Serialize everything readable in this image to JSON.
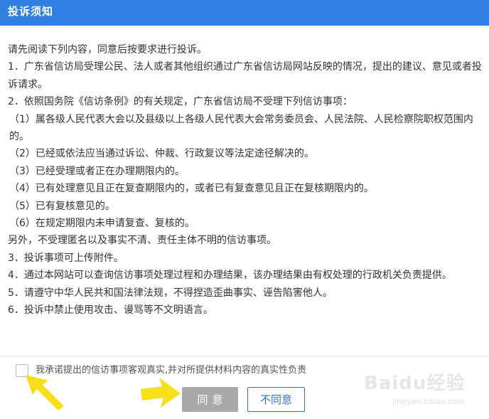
{
  "dialog": {
    "title": "投诉须知"
  },
  "content": {
    "intro": "请先阅读下列内容，同意后按要求进行投诉。",
    "items": [
      "1．广东省信访局受理公民、法人或者其他组织通过广东省信访局网站反映的情况，提出的建议、意见或者投诉请求。",
      "2．依照国务院《信访条例》的有关规定，广东省信访局不受理下列信访事项：",
      "（1）属各级人民代表大会以及县级以上各级人民代表大会常务委员会、人民法院、人民检察院职权范围内的。",
      "（2）已经或依法应当通过诉讼、仲裁、行政复议等法定途径解决的。",
      "（3）已经受理或者正在办理期限内的。",
      "（4）已有处理意见且正在复查期限内的，或者已有复查意见且正在复核期限内的。",
      "（5）已有复核意见的。",
      "（6）在规定期限内未申请复查、复核的。",
      "另外，不受理匿名以及事实不清、责任主体不明的信访事项。",
      "3．投诉事项可上传附件。",
      "4．通过本网站可以查询信访事项处理过程和办理结果，该办理结果由有权处理的行政机关负责提供。",
      "5．请遵守中华人民共和国法律法规，不得捏造歪曲事实、诬告陷害他人。",
      "6．投诉中禁止使用攻击、谩骂等不文明语言。"
    ]
  },
  "footer": {
    "agree_checkbox_label": "我承诺提出的信访事项客观真实,并对所提供材料内容的真实性负责",
    "agree_checked": false,
    "agree_button": "同意",
    "disagree_button": "不同意"
  },
  "watermark": {
    "main": "Baidu经验",
    "sub": "jingyan.baidu.com"
  },
  "colors": {
    "title_bar": "#2f80e0",
    "agree_button_bg": "#a9a9a9",
    "disagree_border": "#2d6fc6",
    "annotation_arrow": "#f7e01a"
  }
}
